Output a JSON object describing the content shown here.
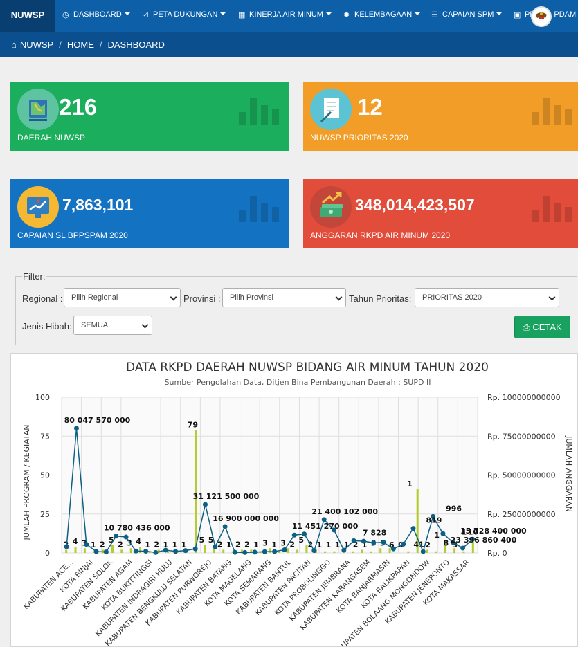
{
  "nav": {
    "brand": "NUWSP",
    "items": [
      {
        "label": "DASHBOARD",
        "icon": "dashboard-icon"
      },
      {
        "label": "PETA DUKUNGAN",
        "icon": "check-square-icon"
      },
      {
        "label": "KINERJA AIR MINUM",
        "icon": "calendar-icon"
      },
      {
        "label": "KELEMBAGAAN",
        "icon": "gear-icon"
      },
      {
        "label": "CAPAIAN SPM",
        "icon": "align-left-icon"
      },
      {
        "label": "PROFIL PDAM",
        "icon": "square-icon"
      }
    ]
  },
  "breadcrumb": [
    "NUWSP",
    "HOME",
    "DASHBOARD"
  ],
  "stats": [
    {
      "value": "216",
      "label": "DAERAH NUWSP",
      "color": "#1aae5d"
    },
    {
      "value": "12",
      "label": "NUWSP PRIORITAS 2020",
      "color": "#f19d28"
    },
    {
      "value": "7,863,101",
      "label": "CAPAIAN SL BPPSPAM 2020",
      "color": "#1472c2"
    },
    {
      "value": "348,014,423,507",
      "label": "ANGGARAN RKPD AIR MINUM 2020",
      "color": "#e24c3b"
    }
  ],
  "filter": {
    "legend": "Filter:",
    "regional_label": "Regional :",
    "regional_value": "Pilih Regional",
    "provinsi_label": "Provinsi :",
    "provinsi_value": "Pilih Provinsi",
    "tahun_label": "Tahun Prioritas:",
    "tahun_value": "PRIORITAS 2020",
    "hibah_label": "Jenis Hibah:",
    "hibah_value": "SEMUA",
    "print_label": "CETAK"
  },
  "chart_data": {
    "type": "bar",
    "title": "DATA RKPD DAERAH NUWSP BIDANG AIR MINUM TAHUN 2020",
    "subtitle": "Sumber Pengolahan Data, Ditjen Bina Pembangunan Daerah : SUPD II",
    "ylabel_left": "JUMLAH PROGRAM / KEGIATAN",
    "ylabel_right": "JUMLAH ANGGARAN",
    "ylim_left": [
      0,
      100
    ],
    "ylim_right": [
      0,
      100000000000
    ],
    "left_ticks": [
      "100",
      "75",
      "50",
      "25",
      "0"
    ],
    "right_ticks": [
      "Rp. 100000000000",
      "Rp. 75000000000",
      "Rp. 50000000000",
      "Rp. 25000000000",
      "Rp. 0"
    ],
    "x_labels": [
      "KABUPATEN ACE...",
      "KOTA BINJAI",
      "KABUPATEN SOLOK",
      "KABUPATEN AGAM",
      "KOTA BUKITTINGGI",
      "KABUPATEN INDRAGIRI HULU",
      "KABUPATEN BENGKULU SELATAN",
      "KABUPATEN PURWOREJO",
      "KABUPATEN BATANG",
      "KOTA MAGELANG",
      "KOTA SEMARANG",
      "KABUPATEN BANTUL",
      "KABUPATEN PACITAN",
      "KOTA PROBOLINGGO",
      "KABUPATEN JEMBRANA",
      "KABUPATEN KARANGASEM",
      "KOTA BANJARMASIN",
      "KOTA BALIKPAPAN",
      "KABUPATEN BOLAANG MONGONDOW",
      "KABUPATEN JENEPONTO",
      "KOTA MAKASSAR"
    ],
    "series": [
      {
        "name": "",
        "kind": "bar",
        "color": "#b5cc2f",
        "values": [
          2,
          4,
          3,
          1,
          2,
          5,
          2,
          3,
          4,
          1,
          2,
          1,
          1,
          1,
          79,
          5,
          5,
          2,
          1,
          2,
          2,
          1,
          3,
          1,
          3,
          2,
          5,
          2,
          1,
          1,
          1,
          1,
          2,
          1,
          3,
          3,
          0,
          1,
          41,
          2,
          1,
          8,
          3,
          1,
          10
        ]
      },
      {
        "name": "",
        "kind": "line",
        "color": "#0e5f84",
        "values": [
          4000000000,
          80047570000,
          5500000000,
          900000000,
          600000000,
          10780436000,
          10200000000,
          1200000000,
          1100000000,
          300000000,
          1800000000,
          1000000000,
          1500000000,
          2600000000,
          31121500000,
          4000000000,
          16900000000,
          400000000,
          300000000,
          500000000,
          800000000,
          900000000,
          2000000000,
          11451270000,
          12100000000,
          1500000000,
          21400102000,
          14700000000,
          1800000000,
          7828000000,
          7500000000,
          6500000000,
          6800000000,
          2600000000,
          5600000000,
          15728400000,
          900000000,
          23396860400,
          12400000000,
          6800000000,
          3100000000,
          8800000000
        ]
      }
    ],
    "bar_labels": [
      "2",
      "4",
      "3",
      "1",
      "2",
      "5",
      "2",
      "3",
      "4",
      "1",
      "2",
      "1",
      "1",
      "1",
      "79",
      "5",
      "5",
      "2",
      "1",
      "2",
      "2",
      "1",
      "3",
      "1",
      "3",
      "2",
      "5",
      "2",
      "1",
      "1",
      "1",
      "1",
      "2",
      "1",
      "3",
      "3",
      "6",
      "0",
      "1",
      "41",
      "2",
      "1",
      "8",
      "3",
      "1",
      "10"
    ],
    "line_labels": [
      "80 047 570 000",
      "10 780 436 000",
      "31 121 500 000",
      "16 900 000 000",
      "11 451 270 000",
      "21 400 102 000",
      "7 828",
      "819",
      "996",
      "15 728 400 000",
      "23 396 860 400"
    ],
    "grid": true,
    "legend": "none"
  }
}
